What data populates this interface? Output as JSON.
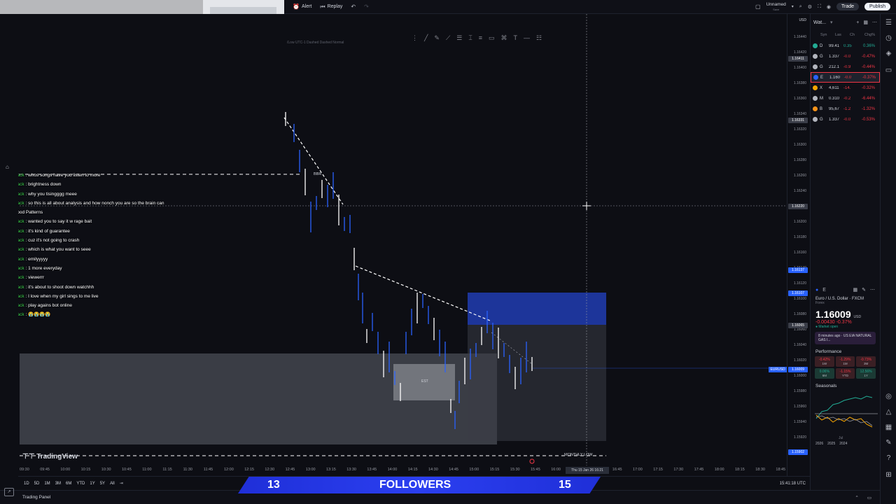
{
  "topbar": {
    "alert": "Alert",
    "replay": "Replay",
    "layout_name": "Unnamed",
    "layout_sub": "Save",
    "trade": "Trade",
    "publish": "Publish"
  },
  "drawing_toolbar": {
    "icons": [
      "cursor-icon",
      "trendline-icon",
      "pencil-icon",
      "fib-icon",
      "channel-icon",
      "text-icon",
      "ruler-icon",
      "rectangle-icon",
      "brush-icon",
      "t-icon",
      "measure-icon",
      "hamburger-icon"
    ]
  },
  "chart": {
    "header_faint": "/Low UTC-1 Dashed Dashed Normal",
    "hline_label": "BBR",
    "est_label": "EST",
    "monthly_low": "MONTHLY LOW",
    "logo": "TradingView",
    "crosshair_time": "Thu 15 Jan 26  16:21",
    "price_ticks": [
      "1.16440",
      "1.16420",
      "1.16400",
      "1.16380",
      "1.16360",
      "1.16340",
      "1.16320",
      "1.16300",
      "1.16280",
      "1.16260",
      "1.16240",
      "1.16220",
      "1.16200",
      "1.16180",
      "1.16160",
      "1.16140",
      "1.16120",
      "1.16100",
      "1.16080",
      "1.16060",
      "1.16040",
      "1.16020",
      "1.16000",
      "1.15980",
      "1.15960",
      "1.15940",
      "1.15920",
      "1.15900"
    ],
    "price_tags": [
      {
        "label": "1.16411",
        "color": "#3a3d48"
      },
      {
        "label": "1.16331",
        "color": "#3a3d48"
      },
      {
        "label": "1.16220",
        "color": "#3a3d48"
      },
      {
        "label": "1.16137",
        "color": "#2962ff"
      },
      {
        "label": "1.16107",
        "color": "#2962ff"
      },
      {
        "label": "1.16065",
        "color": "#3a3d48"
      },
      {
        "label": "1.16009",
        "color": "#2962ff"
      },
      {
        "label": "1.15902",
        "color": "#2962ff"
      }
    ],
    "symbol_tag": "EURUSD",
    "time_ticks": [
      "09:30",
      "09:45",
      "10:00",
      "10:15",
      "10:30",
      "10:45",
      "11:00",
      "11:15",
      "11:30",
      "11:45",
      "12:00",
      "12:15",
      "12:30",
      "12:45",
      "13:00",
      "13:15",
      "13:30",
      "13:45",
      "14:00",
      "14:15",
      "14:30",
      "14:45",
      "15:00",
      "15:15",
      "15:30",
      "15:45",
      "16:00",
      "16:15",
      "16:30",
      "16:45",
      "17:00",
      "17:15",
      "17:30",
      "17:45",
      "18:00",
      "18:15",
      "18:30",
      "18:45"
    ],
    "currency": "USD"
  },
  "chat": [
    {
      "user": "tonistack",
      "msg": "whos songs have you listen to more"
    },
    {
      "user": "tonistack",
      "msg": "brightness down"
    },
    {
      "user": "tonistack",
      "msg": "why you tisingggg meee"
    },
    {
      "user": "tonistack",
      "msg": "so this is all about analysis and how nonch you are so the brain can"
    },
    {
      "user": "",
      "msg": "pickup good Patterns"
    },
    {
      "user": "tonistack",
      "msg": "wanted you to say it w rage bait"
    },
    {
      "user": "tonistack",
      "msg": "it's kind of guarantee"
    },
    {
      "user": "tonistack",
      "msg": "cuz it's not going to crash"
    },
    {
      "user": "tonistack",
      "msg": "which is what you want to seee"
    },
    {
      "user": "tonistack",
      "msg": "emilyyyyy"
    },
    {
      "user": "tonistack",
      "msg": "1 more everyday"
    },
    {
      "user": "tonistack",
      "msg": "viewerrr"
    },
    {
      "user": "tonistack",
      "msg": "it's about to shoot down watchhh"
    },
    {
      "user": "tonistack",
      "msg": "I love when my girl sings to me live"
    },
    {
      "user": "tonistack",
      "msg": "play agains bot online"
    },
    {
      "user": "tonistack",
      "msg": "😭😭😭😭"
    }
  ],
  "watchlist": {
    "title": "Wat...",
    "cols": [
      "Syn",
      "Las",
      "Ch",
      "Chg%"
    ],
    "rows": [
      {
        "sym": "D",
        "last": "99.41",
        "chg": "0.35",
        "pct": "0.36%",
        "up": true,
        "dot": "#22ab94"
      },
      {
        "sym": "G",
        "last": "1.337",
        "chg": "-0.0",
        "pct": "-0.47%",
        "up": false,
        "dot": "#b2b5be"
      },
      {
        "sym": "G",
        "last": "212.1",
        "chg": "-0.9",
        "pct": "-0.44%",
        "up": false,
        "dot": "#b2b5be"
      },
      {
        "sym": "E",
        "last": "1.160",
        "chg": "-0.0",
        "pct": "-0.37%",
        "up": false,
        "dot": "#2962ff",
        "sel": true
      },
      {
        "sym": "X",
        "last": "4,611",
        "chg": "-14.",
        "pct": "-0.32%",
        "up": false,
        "dot": "#f7a600"
      },
      {
        "sym": "M",
        "last": "0.310",
        "chg": "-0.2",
        "pct": "-6.44%",
        "up": false,
        "dot": "#b2b5be"
      },
      {
        "sym": "B",
        "last": "95,67",
        "chg": "-1.2",
        "pct": "-1.32%",
        "up": false,
        "dot": "#f7931a"
      },
      {
        "sym": "G",
        "last": "1.337",
        "chg": "-0.0",
        "pct": "-0.53%",
        "up": false,
        "dot": "#b2b5be"
      }
    ]
  },
  "details": {
    "symbol_short": "E",
    "title": "Euro / U.S. Dollar · FXCM",
    "type": "Forex",
    "price": "1.16009",
    "currency": "USD",
    "change": "-0.00430  -0.37%",
    "status": "● Market open",
    "news": "8 minutes ago · US  EIA NATURAL GAS I...",
    "performance_label": "Performance",
    "perf": [
      {
        "v": "-0.42%",
        "l": "1W",
        "up": false
      },
      {
        "v": "-1.29%",
        "l": "1M",
        "up": false
      },
      {
        "v": "-0.73%",
        "l": "3M",
        "up": false
      },
      {
        "v": "0.06%",
        "l": "6M",
        "up": true
      },
      {
        "v": "-1.15%",
        "l": "YTD",
        "up": false
      },
      {
        "v": "12.56%",
        "l": "1Y",
        "up": true
      }
    ],
    "seasonals_label": "Seasonals",
    "season_month": "Jul",
    "season_years": [
      "2026",
      "2025",
      "2024"
    ]
  },
  "bottom_toolbar": {
    "ranges": [
      "1D",
      "5D",
      "1M",
      "3M",
      "6M",
      "YTD",
      "1Y",
      "5Y",
      "All"
    ],
    "clock": "15:41:18 UTC"
  },
  "status_bar": {
    "trading_panel": "Trading Panel"
  },
  "overlay": {
    "count_left": "13",
    "label": "FOLLOWERS",
    "count_right": "15"
  },
  "colors": {
    "accent": "#2962ff",
    "down": "#f23645",
    "up": "#22ab94",
    "chat_user": "#3bd24b",
    "zone_blue": "#1f3aa8"
  }
}
